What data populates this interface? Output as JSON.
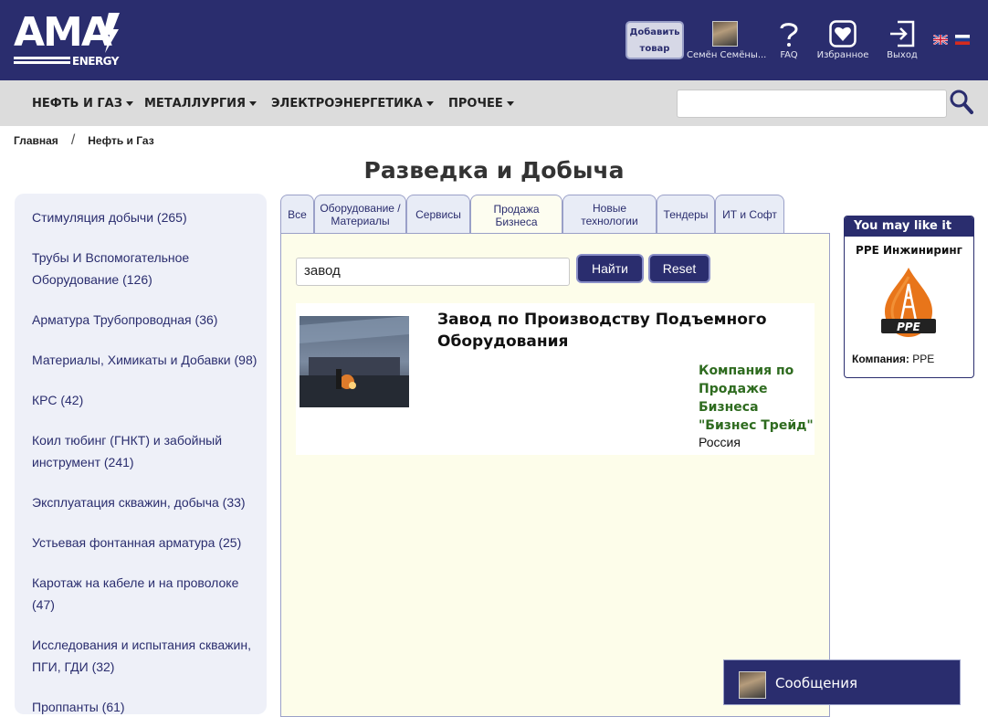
{
  "header": {
    "logo_text": "AMA",
    "logo_sub": "ENERGY",
    "add_product_label": "Добавить товар",
    "user_name": "Семён Семёны...",
    "faq_label": "FAQ",
    "favorites_label": "Избранное",
    "logout_label": "Выход",
    "faq_icon": "question-mark-icon",
    "favorites_icon": "heart-icon",
    "logout_icon": "logout-icon"
  },
  "nav": {
    "items": [
      {
        "label": "НЕФТЬ И ГАЗ"
      },
      {
        "label": "МЕТАЛЛУРГИЯ"
      },
      {
        "label": "ЭЛЕКТРОЭНЕРГЕТИКА"
      },
      {
        "label": "ПРОЧЕЕ"
      }
    ],
    "search_value": ""
  },
  "breadcrumb": {
    "home": "Главная",
    "separator": "/",
    "current": "Нефть и Газ"
  },
  "page_title": "Разведка и Добыча",
  "sidebar": {
    "items": [
      {
        "label": "Стимуляция добычи (265)"
      },
      {
        "label": "Трубы И Вспомогательное Оборудование (126)"
      },
      {
        "label": "Арматура Трубопроводная (36)"
      },
      {
        "label": "Материалы, Химикаты и Добавки (98)"
      },
      {
        "label": "КРС (42)"
      },
      {
        "label": "Коил тюбинг (ГНКТ) и забойный инструмент (241)"
      },
      {
        "label": "Эксплуатация скважин, добыча (33)"
      },
      {
        "label": "Устьевая фонтанная арматура (25)"
      },
      {
        "label": "Каротаж на кабеле и на проволоке (47)"
      },
      {
        "label": "Исследования и испытания скважин, ПГИ, ГДИ (32)"
      },
      {
        "label": "Проппанты (61)"
      }
    ]
  },
  "tabs": [
    {
      "label": "Все"
    },
    {
      "label": "Оборудование / Материалы"
    },
    {
      "label": "Сервисы"
    },
    {
      "label": "Продажа Бизнеса"
    },
    {
      "label": "Новые технологии"
    },
    {
      "label": "Тендеры"
    },
    {
      "label": "ИТ и Софт"
    }
  ],
  "active_tab": "Продажа Бизнеса",
  "search": {
    "value": "завод",
    "find_label": "Найти",
    "reset_label": "Reset"
  },
  "results": [
    {
      "title": "Завод по Производству Подъемного Оборудования",
      "company": "Компания по Продаже Бизнеса \"Бизнес Трейд\"",
      "country": "Россия"
    }
  ],
  "ad": {
    "heading": "You may like it",
    "name": "PPE Инжиниринг",
    "logo_text": "PPE",
    "company_label": "Компания:",
    "company_value": "PPE"
  },
  "messages": {
    "label": "Сообщения"
  },
  "colors": {
    "brand": "#2a2d6e",
    "nav_bg": "#dcdcdc",
    "company_green": "#2e6b1f",
    "content_bg": "#fdfdea"
  }
}
